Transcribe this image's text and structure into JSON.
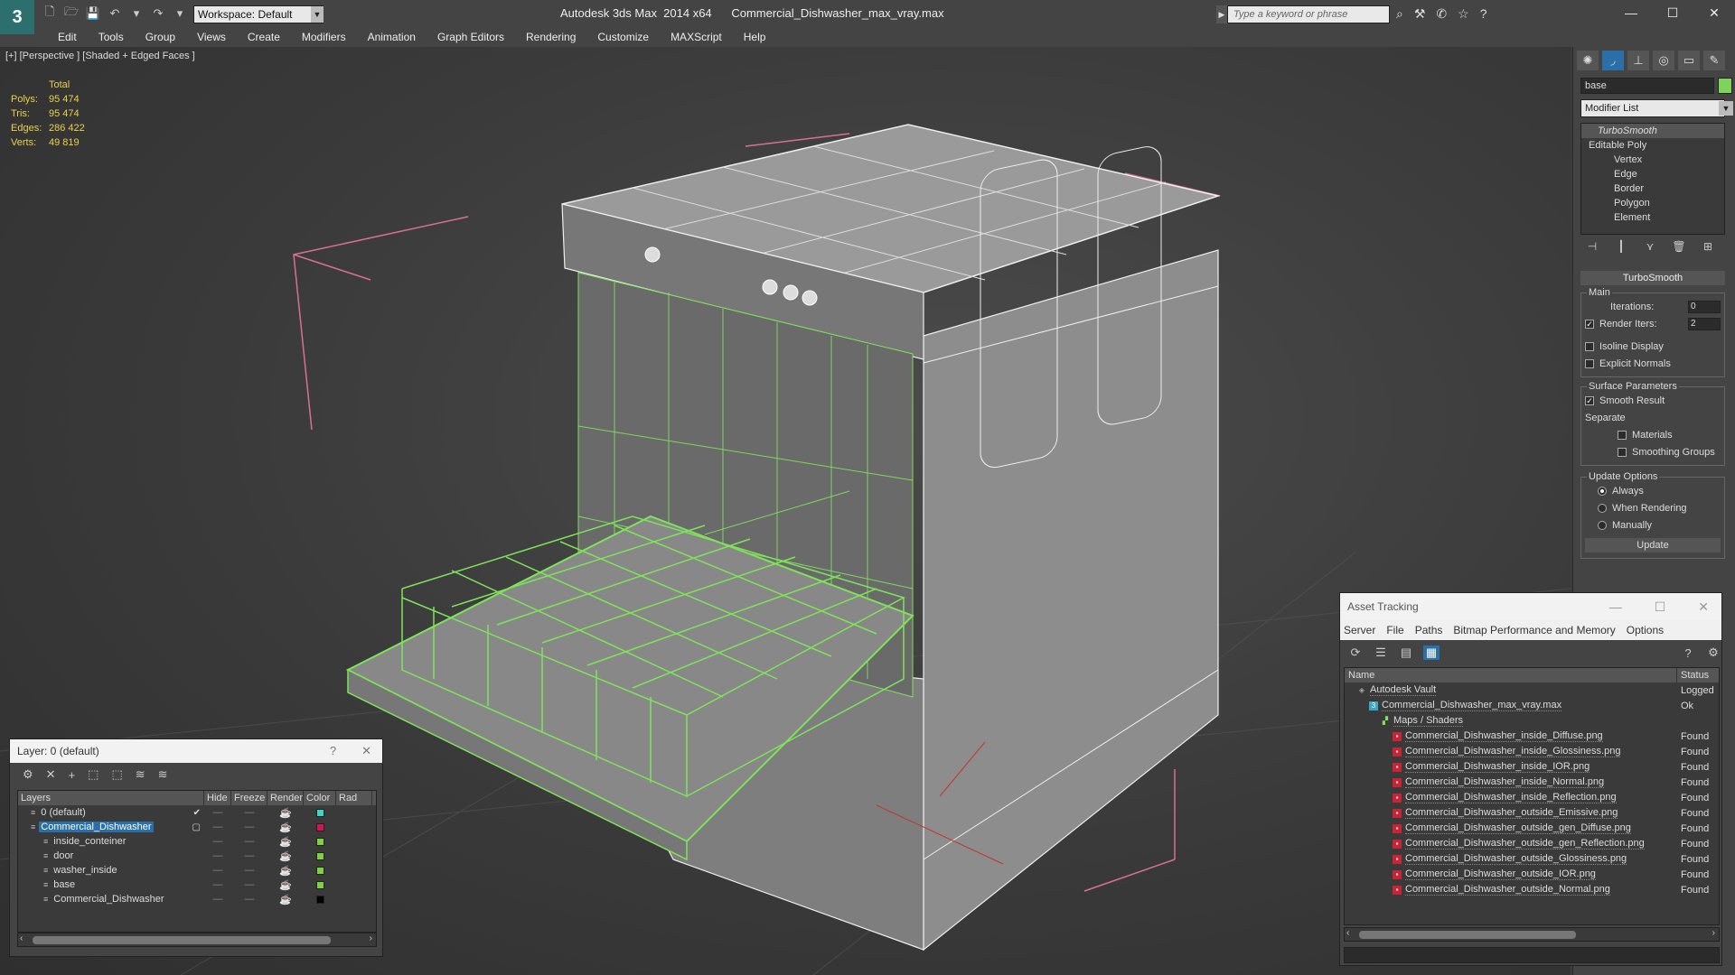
{
  "app": {
    "logo": "3",
    "title": "Autodesk 3ds Max  2014 x64      Commercial_Dishwasher_max_vray.max",
    "workspace": "Workspace: Default",
    "search_placeholder": "Type a keyword or phrase"
  },
  "menu": [
    "Edit",
    "Tools",
    "Group",
    "Views",
    "Create",
    "Modifiers",
    "Animation",
    "Graph Editors",
    "Rendering",
    "Customize",
    "MAXScript",
    "Help"
  ],
  "viewport": {
    "label": "[+] [Perspective ] [Shaded + Edged Faces ]",
    "stats": {
      "header": "Total",
      "rows": [
        {
          "k": "Polys:",
          "v": "95 474"
        },
        {
          "k": "Tris:",
          "v": "95 474"
        },
        {
          "k": "Edges:",
          "v": "286 422"
        },
        {
          "k": "Verts:",
          "v": "49 819"
        }
      ]
    }
  },
  "command_panel": {
    "object_name": "base",
    "modifier_list": "Modifier List",
    "stack": {
      "turbosmooth": "TurboSmooth",
      "editable_poly": "Editable Poly",
      "subs": [
        "Vertex",
        "Edge",
        "Border",
        "Polygon",
        "Element"
      ]
    },
    "rollout_title": "TurboSmooth",
    "main": {
      "title": "Main",
      "iterations_label": "Iterations:",
      "iterations_value": "0",
      "render_iters_label": "Render Iters:",
      "render_iters_value": "2",
      "isoline": "Isoline Display",
      "explicit_normals": "Explicit Normals"
    },
    "surface": {
      "title": "Surface Parameters",
      "smooth_result": "Smooth Result",
      "separate": "Separate",
      "materials": "Materials",
      "smoothing_groups": "Smoothing Groups"
    },
    "update": {
      "title": "Update Options",
      "always": "Always",
      "when_rendering": "When Rendering",
      "manually": "Manually",
      "button": "Update"
    }
  },
  "layer_window": {
    "title": "Layer: 0 (default)",
    "help": "?",
    "close": "✕",
    "columns": {
      "layers": "Layers",
      "hide": "Hide",
      "freeze": "Freeze",
      "render": "Render",
      "color": "Color",
      "rad": "Rad"
    },
    "rows": [
      {
        "name": "0 (default)",
        "color": "#3bd6c6",
        "level": 0,
        "selected": false,
        "check": "✔"
      },
      {
        "name": "Commercial_Dishwasher",
        "color": "#d4145a",
        "level": 0,
        "selected": true,
        "check": "▢"
      },
      {
        "name": "inside_conteiner",
        "color": "#7ed23c",
        "level": 1,
        "selected": false,
        "check": ""
      },
      {
        "name": "door",
        "color": "#7ed23c",
        "level": 1,
        "selected": false,
        "check": ""
      },
      {
        "name": "washer_inside",
        "color": "#7ed23c",
        "level": 1,
        "selected": false,
        "check": ""
      },
      {
        "name": "base",
        "color": "#7ed23c",
        "level": 1,
        "selected": false,
        "check": ""
      },
      {
        "name": "Commercial_Dishwasher",
        "color": "#000000",
        "level": 1,
        "selected": false,
        "check": ""
      }
    ]
  },
  "asset_tracking": {
    "title": "Asset Tracking",
    "menu": [
      "Server",
      "File",
      "Paths",
      "Bitmap Performance and Memory",
      "Options"
    ],
    "col_name": "Name",
    "col_status": "Status",
    "rows": [
      {
        "name": "Autodesk Vault",
        "status": "Logged",
        "icon": "vault",
        "indent": 0
      },
      {
        "name": "Commercial_Dishwasher_max_vray.max",
        "status": "Ok",
        "icon": "max",
        "indent": 1
      },
      {
        "name": "Maps / Shaders",
        "status": "",
        "icon": "maps",
        "indent": 2
      },
      {
        "name": "Commercial_Dishwasher_inside_Diffuse.png",
        "status": "Found",
        "icon": "png",
        "indent": 3
      },
      {
        "name": "Commercial_Dishwasher_inside_Glossiness.png",
        "status": "Found",
        "icon": "png",
        "indent": 3
      },
      {
        "name": "Commercial_Dishwasher_inside_IOR.png",
        "status": "Found",
        "icon": "png",
        "indent": 3
      },
      {
        "name": "Commercial_Dishwasher_inside_Normal.png",
        "status": "Found",
        "icon": "png",
        "indent": 3
      },
      {
        "name": "Commercial_Dishwasher_inside_Reflection.png",
        "status": "Found",
        "icon": "png",
        "indent": 3
      },
      {
        "name": "Commercial_Dishwasher_outside_Emissive.png",
        "status": "Found",
        "icon": "png",
        "indent": 3
      },
      {
        "name": "Commercial_Dishwasher_outside_gen_Diffuse.png",
        "status": "Found",
        "icon": "png",
        "indent": 3
      },
      {
        "name": "Commercial_Dishwasher_outside_gen_Reflection.png",
        "status": "Found",
        "icon": "png",
        "indent": 3
      },
      {
        "name": "Commercial_Dishwasher_outside_Glossiness.png",
        "status": "Found",
        "icon": "png",
        "indent": 3
      },
      {
        "name": "Commercial_Dishwasher_outside_IOR.png",
        "status": "Found",
        "icon": "png",
        "indent": 3
      },
      {
        "name": "Commercial_Dishwasher_outside_Normal.png",
        "status": "Found",
        "icon": "png",
        "indent": 3
      }
    ]
  },
  "colors": {
    "accent": "#2a6fa8",
    "wire_green": "#7fe35a",
    "stats_yellow": "#e8d24a"
  }
}
